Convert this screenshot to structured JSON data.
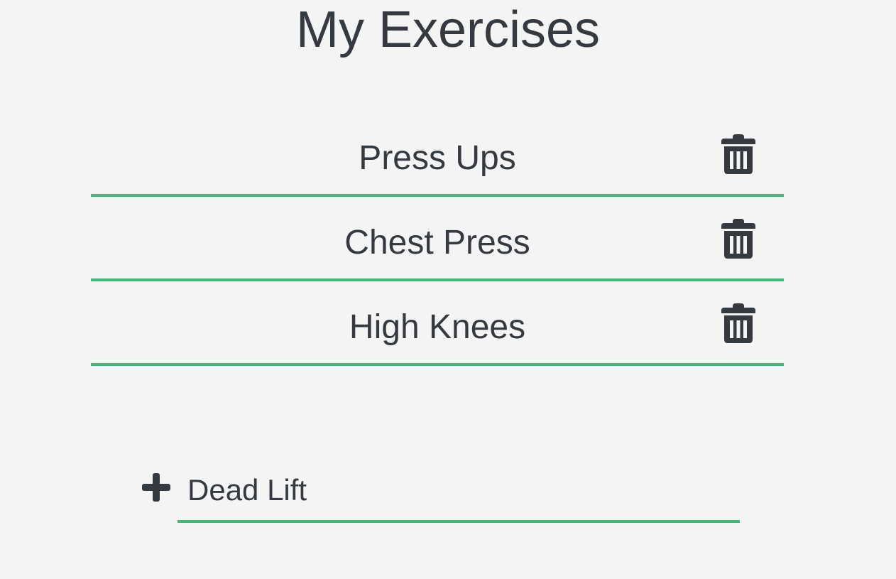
{
  "page": {
    "title": "My Exercises"
  },
  "exercises": [
    {
      "name": "Press Ups",
      "delete_icon": "trash-icon"
    },
    {
      "name": "Chest Press",
      "delete_icon": "trash-icon"
    },
    {
      "name": "High Knees",
      "delete_icon": "trash-icon"
    }
  ],
  "add_form": {
    "icon": "plus-icon",
    "value": "Dead Lift",
    "placeholder": ""
  },
  "colors": {
    "accent": "#3dba78",
    "text": "#343a40",
    "background": "#f4f4f4"
  }
}
